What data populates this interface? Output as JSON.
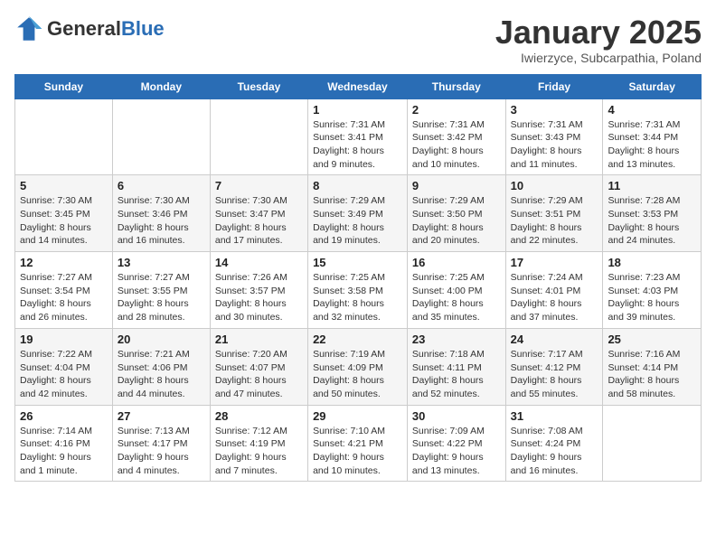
{
  "logo": {
    "general": "General",
    "blue": "Blue"
  },
  "title": "January 2025",
  "location": "Iwierzyce, Subcarpathia, Poland",
  "days_of_week": [
    "Sunday",
    "Monday",
    "Tuesday",
    "Wednesday",
    "Thursday",
    "Friday",
    "Saturday"
  ],
  "weeks": [
    [
      {
        "day": "",
        "content": ""
      },
      {
        "day": "",
        "content": ""
      },
      {
        "day": "",
        "content": ""
      },
      {
        "day": "1",
        "content": "Sunrise: 7:31 AM\nSunset: 3:41 PM\nDaylight: 8 hours\nand 9 minutes."
      },
      {
        "day": "2",
        "content": "Sunrise: 7:31 AM\nSunset: 3:42 PM\nDaylight: 8 hours\nand 10 minutes."
      },
      {
        "day": "3",
        "content": "Sunrise: 7:31 AM\nSunset: 3:43 PM\nDaylight: 8 hours\nand 11 minutes."
      },
      {
        "day": "4",
        "content": "Sunrise: 7:31 AM\nSunset: 3:44 PM\nDaylight: 8 hours\nand 13 minutes."
      }
    ],
    [
      {
        "day": "5",
        "content": "Sunrise: 7:30 AM\nSunset: 3:45 PM\nDaylight: 8 hours\nand 14 minutes."
      },
      {
        "day": "6",
        "content": "Sunrise: 7:30 AM\nSunset: 3:46 PM\nDaylight: 8 hours\nand 16 minutes."
      },
      {
        "day": "7",
        "content": "Sunrise: 7:30 AM\nSunset: 3:47 PM\nDaylight: 8 hours\nand 17 minutes."
      },
      {
        "day": "8",
        "content": "Sunrise: 7:29 AM\nSunset: 3:49 PM\nDaylight: 8 hours\nand 19 minutes."
      },
      {
        "day": "9",
        "content": "Sunrise: 7:29 AM\nSunset: 3:50 PM\nDaylight: 8 hours\nand 20 minutes."
      },
      {
        "day": "10",
        "content": "Sunrise: 7:29 AM\nSunset: 3:51 PM\nDaylight: 8 hours\nand 22 minutes."
      },
      {
        "day": "11",
        "content": "Sunrise: 7:28 AM\nSunset: 3:53 PM\nDaylight: 8 hours\nand 24 minutes."
      }
    ],
    [
      {
        "day": "12",
        "content": "Sunrise: 7:27 AM\nSunset: 3:54 PM\nDaylight: 8 hours\nand 26 minutes."
      },
      {
        "day": "13",
        "content": "Sunrise: 7:27 AM\nSunset: 3:55 PM\nDaylight: 8 hours\nand 28 minutes."
      },
      {
        "day": "14",
        "content": "Sunrise: 7:26 AM\nSunset: 3:57 PM\nDaylight: 8 hours\nand 30 minutes."
      },
      {
        "day": "15",
        "content": "Sunrise: 7:25 AM\nSunset: 3:58 PM\nDaylight: 8 hours\nand 32 minutes."
      },
      {
        "day": "16",
        "content": "Sunrise: 7:25 AM\nSunset: 4:00 PM\nDaylight: 8 hours\nand 35 minutes."
      },
      {
        "day": "17",
        "content": "Sunrise: 7:24 AM\nSunset: 4:01 PM\nDaylight: 8 hours\nand 37 minutes."
      },
      {
        "day": "18",
        "content": "Sunrise: 7:23 AM\nSunset: 4:03 PM\nDaylight: 8 hours\nand 39 minutes."
      }
    ],
    [
      {
        "day": "19",
        "content": "Sunrise: 7:22 AM\nSunset: 4:04 PM\nDaylight: 8 hours\nand 42 minutes."
      },
      {
        "day": "20",
        "content": "Sunrise: 7:21 AM\nSunset: 4:06 PM\nDaylight: 8 hours\nand 44 minutes."
      },
      {
        "day": "21",
        "content": "Sunrise: 7:20 AM\nSunset: 4:07 PM\nDaylight: 8 hours\nand 47 minutes."
      },
      {
        "day": "22",
        "content": "Sunrise: 7:19 AM\nSunset: 4:09 PM\nDaylight: 8 hours\nand 50 minutes."
      },
      {
        "day": "23",
        "content": "Sunrise: 7:18 AM\nSunset: 4:11 PM\nDaylight: 8 hours\nand 52 minutes."
      },
      {
        "day": "24",
        "content": "Sunrise: 7:17 AM\nSunset: 4:12 PM\nDaylight: 8 hours\nand 55 minutes."
      },
      {
        "day": "25",
        "content": "Sunrise: 7:16 AM\nSunset: 4:14 PM\nDaylight: 8 hours\nand 58 minutes."
      }
    ],
    [
      {
        "day": "26",
        "content": "Sunrise: 7:14 AM\nSunset: 4:16 PM\nDaylight: 9 hours\nand 1 minute."
      },
      {
        "day": "27",
        "content": "Sunrise: 7:13 AM\nSunset: 4:17 PM\nDaylight: 9 hours\nand 4 minutes."
      },
      {
        "day": "28",
        "content": "Sunrise: 7:12 AM\nSunset: 4:19 PM\nDaylight: 9 hours\nand 7 minutes."
      },
      {
        "day": "29",
        "content": "Sunrise: 7:10 AM\nSunset: 4:21 PM\nDaylight: 9 hours\nand 10 minutes."
      },
      {
        "day": "30",
        "content": "Sunrise: 7:09 AM\nSunset: 4:22 PM\nDaylight: 9 hours\nand 13 minutes."
      },
      {
        "day": "31",
        "content": "Sunrise: 7:08 AM\nSunset: 4:24 PM\nDaylight: 9 hours\nand 16 minutes."
      },
      {
        "day": "",
        "content": ""
      }
    ]
  ]
}
